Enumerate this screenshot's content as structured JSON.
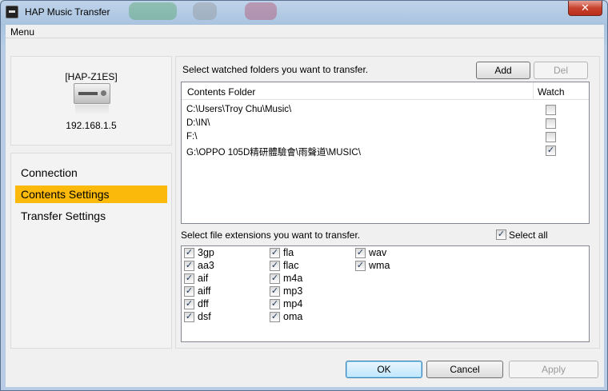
{
  "window": {
    "title": "HAP Music Transfer",
    "close_glyph": "✕"
  },
  "menu": {
    "label": "Menu"
  },
  "device": {
    "name": "[HAP-Z1ES]",
    "ip": "192.168.1.5"
  },
  "nav": {
    "items": [
      {
        "label": "Connection"
      },
      {
        "label": "Contents Settings"
      },
      {
        "label": "Transfer Settings"
      }
    ]
  },
  "folders": {
    "instruction": "Select watched folders you want to transfer.",
    "add_label": "Add",
    "del_label": "Del",
    "col_folder": "Contents Folder",
    "col_watch": "Watch",
    "rows": [
      {
        "path": "C:\\Users\\Troy Chu\\Music\\",
        "watched": false
      },
      {
        "path": "D:\\IN\\",
        "watched": false
      },
      {
        "path": "F:\\",
        "watched": false
      },
      {
        "path": "G:\\OPPO 105D精研體驗會\\雨聲道\\MUSIC\\",
        "watched": true
      }
    ]
  },
  "extensions": {
    "instruction": "Select file extensions you want to transfer.",
    "select_all_label": "Select all",
    "select_all_checked": true,
    "items": [
      {
        "name": "3gp",
        "checked": true
      },
      {
        "name": "aa3",
        "checked": true
      },
      {
        "name": "aif",
        "checked": true
      },
      {
        "name": "aiff",
        "checked": true
      },
      {
        "name": "dff",
        "checked": true
      },
      {
        "name": "dsf",
        "checked": true
      },
      {
        "name": "fla",
        "checked": true
      },
      {
        "name": "flac",
        "checked": true
      },
      {
        "name": "m4a",
        "checked": true
      },
      {
        "name": "mp3",
        "checked": true
      },
      {
        "name": "mp4",
        "checked": true
      },
      {
        "name": "oma",
        "checked": true
      },
      {
        "name": "wav",
        "checked": true
      },
      {
        "name": "wma",
        "checked": true
      }
    ]
  },
  "footer": {
    "ok_label": "OK",
    "cancel_label": "Cancel",
    "apply_label": "Apply"
  },
  "colors": {
    "selected_nav": "#fbb90b",
    "check_mark": "#21385d"
  }
}
